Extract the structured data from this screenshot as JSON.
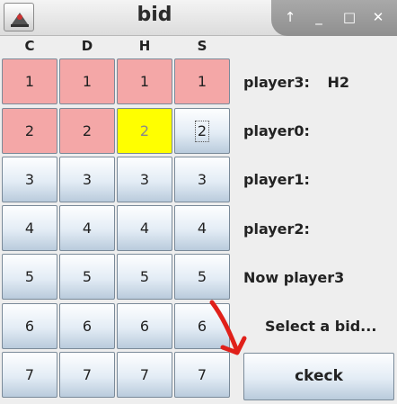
{
  "window": {
    "title": "bid",
    "controls": [
      "↑",
      "_",
      "□",
      "✕"
    ]
  },
  "columns": [
    "C",
    "D",
    "H",
    "S"
  ],
  "bid_rows": [
    {
      "value": "1",
      "states": [
        "used",
        "used",
        "used",
        "used"
      ]
    },
    {
      "value": "2",
      "states": [
        "used",
        "used",
        "selected",
        "focused"
      ]
    },
    {
      "value": "3",
      "states": [
        "normal",
        "normal",
        "normal",
        "normal"
      ]
    },
    {
      "value": "4",
      "states": [
        "normal",
        "normal",
        "normal",
        "normal"
      ]
    },
    {
      "value": "5",
      "states": [
        "normal",
        "normal",
        "normal",
        "normal"
      ]
    },
    {
      "value": "6",
      "states": [
        "normal",
        "normal",
        "normal",
        "normal"
      ]
    },
    {
      "value": "7",
      "states": [
        "normal",
        "normal",
        "normal",
        "normal"
      ]
    }
  ],
  "players": [
    {
      "label": "player3:",
      "bid": "H2"
    },
    {
      "label": "player0:",
      "bid": ""
    },
    {
      "label": "player1:",
      "bid": ""
    },
    {
      "label": "player2:",
      "bid": ""
    }
  ],
  "turn_text": "Now player3",
  "status_text": "Select a bid...",
  "check_button_label": "ckeck",
  "colors": {
    "used_bid": "#f4a7a7",
    "selected_bid": "#ffff00",
    "annotation_arrow": "#e0201a"
  }
}
